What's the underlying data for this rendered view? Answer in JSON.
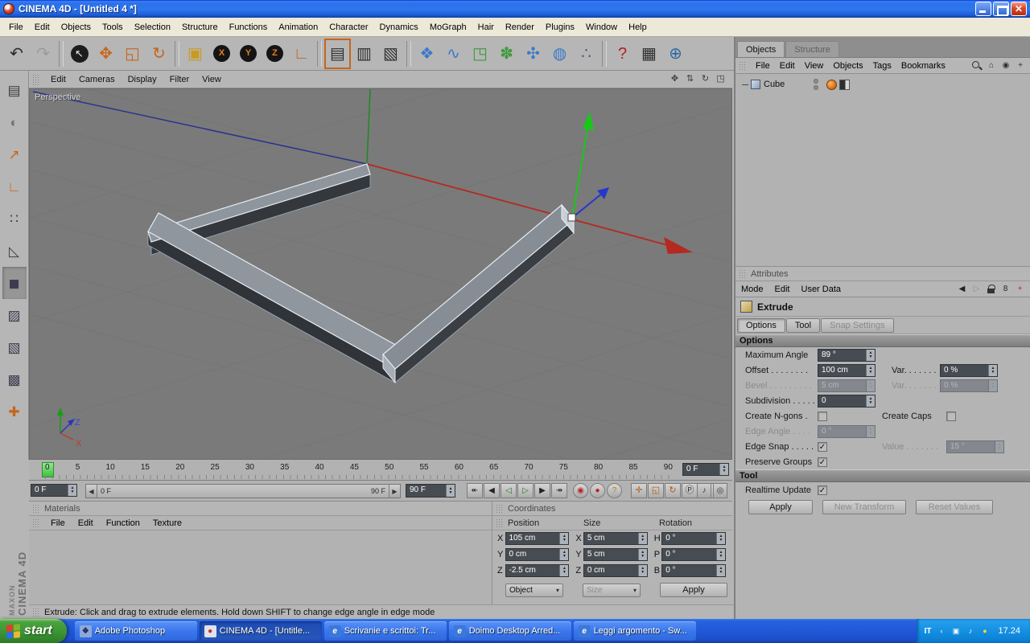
{
  "window": {
    "title": "CINEMA 4D - [Untitled 4 *]"
  },
  "app_menu": [
    "File",
    "Edit",
    "Objects",
    "Tools",
    "Selection",
    "Structure",
    "Functions",
    "Animation",
    "Character",
    "Dynamics",
    "MoGraph",
    "Hair",
    "Render",
    "Plugins",
    "Window",
    "Help"
  ],
  "toolbar": {
    "icons": [
      {
        "name": "undo-icon",
        "glyph": "↶",
        "color": "#2a2a2a"
      },
      {
        "name": "redo-icon",
        "glyph": "↷",
        "color": "#9b9b9b"
      },
      {
        "name": "sep"
      },
      {
        "name": "live-selection-icon",
        "glyph": "↖",
        "kind": "round"
      },
      {
        "name": "move-icon",
        "glyph": "✥",
        "color": "#c8651c"
      },
      {
        "name": "scale-icon",
        "glyph": "◱",
        "color": "#c8651c"
      },
      {
        "name": "rotate-icon",
        "glyph": "↻",
        "color": "#c8651c"
      },
      {
        "name": "sep"
      },
      {
        "name": "last-used-tool-icon",
        "glyph": "▣",
        "color": "#c99b1d"
      },
      {
        "name": "lock-x-icon",
        "kind": "lock",
        "letter": "X"
      },
      {
        "name": "lock-y-icon",
        "kind": "lock",
        "letter": "Y"
      },
      {
        "name": "lock-z-icon",
        "kind": "lock",
        "letter": "Z"
      },
      {
        "name": "coordinate-system-icon",
        "glyph": "∟",
        "color": "#c8651c"
      },
      {
        "name": "sep"
      },
      {
        "name": "render-view-icon",
        "glyph": "▤",
        "color": "#2e2e2e",
        "framed": true
      },
      {
        "name": "render-active-objects-icon",
        "glyph": "▥",
        "color": "#2e2e2e"
      },
      {
        "name": "render-settings-icon",
        "glyph": "▧",
        "color": "#2e2e2e"
      },
      {
        "name": "sep"
      },
      {
        "name": "add-primitive-icon",
        "glyph": "❖",
        "color": "#3a79c9"
      },
      {
        "name": "add-spline-icon",
        "glyph": "∿",
        "color": "#3a79c9"
      },
      {
        "name": "add-nurbs-icon",
        "glyph": "◳",
        "color": "#3f9a3f"
      },
      {
        "name": "add-modeling-icon",
        "glyph": "✽",
        "color": "#3f9a3f"
      },
      {
        "name": "add-deformer-icon",
        "glyph": "✣",
        "color": "#3a79c9"
      },
      {
        "name": "add-environment-icon",
        "glyph": "◍",
        "color": "#3a79c9"
      },
      {
        "name": "add-particles-icon",
        "glyph": "∴",
        "color": "#555577"
      },
      {
        "name": "sep"
      },
      {
        "name": "help-icon",
        "glyph": "?",
        "color": "#b32020"
      },
      {
        "name": "command-manager-icon",
        "glyph": "▦",
        "color": "#2e2e2e"
      },
      {
        "name": "online-help-icon",
        "glyph": "⊕",
        "color": "#2a6aa0"
      }
    ]
  },
  "left_toolbar": {
    "icons": [
      {
        "name": "layout-icon",
        "glyph": "▤",
        "color": "#3e3e3e"
      },
      {
        "name": "make-editable-icon",
        "glyph": "◐",
        "color": "#757575"
      },
      {
        "name": "model-mode-icon",
        "glyph": "↗",
        "color": "#c8651c"
      },
      {
        "name": "object-axis-mode-icon",
        "glyph": "∟",
        "color": "#c8651c"
      },
      {
        "name": "points-mode-icon",
        "glyph": "∷",
        "color": "#3c3c50"
      },
      {
        "name": "edges-mode-icon",
        "glyph": "◺",
        "color": "#3c3c50"
      },
      {
        "name": "polygons-mode-icon",
        "glyph": "◼",
        "color": "#3c3c50",
        "pressed": true
      },
      {
        "name": "texture-mode-icon",
        "glyph": "▨",
        "color": "#3c3c50"
      },
      {
        "name": "texture-axis-mode-icon",
        "glyph": "▧",
        "color": "#3c3c50"
      },
      {
        "name": "uv-mode-icon",
        "glyph": "▩",
        "color": "#3c3c50"
      },
      {
        "name": "snap-settings-icon",
        "glyph": "✚",
        "color": "#c8651c"
      }
    ]
  },
  "viewport": {
    "menu": [
      "Edit",
      "Cameras",
      "Display",
      "Filter",
      "View"
    ],
    "camera_icons": [
      {
        "name": "camera-pan-icon",
        "glyph": "✥"
      },
      {
        "name": "camera-zoom-icon",
        "glyph": "⇅"
      },
      {
        "name": "camera-rotate-icon",
        "glyph": "↻"
      },
      {
        "name": "viewport-toggle-icon",
        "glyph": "◳"
      }
    ],
    "label": "Perspective",
    "axis_labels": {
      "z": "Z",
      "x": "X"
    }
  },
  "timeline": {
    "ticks": [
      "0",
      "5",
      "10",
      "15",
      "20",
      "25",
      "30",
      "35",
      "40",
      "45",
      "50",
      "55",
      "60",
      "65",
      "70",
      "75",
      "80",
      "85",
      "90"
    ],
    "current_frame": "0 F",
    "range_start": "0 F",
    "range_end": "90 F",
    "end_frame": "90 F",
    "transport": [
      {
        "name": "goto-start-button",
        "glyph": "↞",
        "color": "#222"
      },
      {
        "name": "previous-key-button",
        "glyph": "◀",
        "color": "#222"
      },
      {
        "name": "previous-frame-button",
        "glyph": "◁",
        "color": "#1d7a1d"
      },
      {
        "name": "play-button",
        "glyph": "▷",
        "color": "#1d7a1d"
      },
      {
        "name": "next-frame-button",
        "glyph": "▶",
        "color": "#222"
      },
      {
        "name": "goto-end-button",
        "glyph": "↠",
        "color": "#222"
      }
    ],
    "record": [
      {
        "name": "record-keyframe-button",
        "glyph": "◉",
        "color": "#c02020"
      },
      {
        "name": "autokeying-button",
        "glyph": "●",
        "color": "#c02020"
      },
      {
        "name": "keying-options-button",
        "glyph": "?",
        "color": "#d07010"
      }
    ],
    "toggles": [
      {
        "name": "record-position-toggle",
        "glyph": "✛",
        "color": "#b35a10"
      },
      {
        "name": "record-scale-toggle",
        "glyph": "◱",
        "color": "#b35a10"
      },
      {
        "name": "record-rotation-toggle",
        "glyph": "↻",
        "color": "#b35a10"
      },
      {
        "name": "record-parameter-toggle",
        "glyph": "Ⓟ",
        "color": "#333333"
      },
      {
        "name": "record-pla-toggle",
        "glyph": "∙",
        "color": "#333333"
      }
    ],
    "end_icons": [
      {
        "name": "sound-toggle",
        "glyph": "♪",
        "color": "#333333"
      },
      {
        "name": "solo-toggle",
        "glyph": "◎",
        "color": "#333333"
      }
    ]
  },
  "materials": {
    "title": "Materials",
    "menu": [
      "File",
      "Edit",
      "Function",
      "Texture"
    ]
  },
  "coordinates": {
    "title": "Coordinates",
    "headers": [
      "Position",
      "Size",
      "Rotation"
    ],
    "rows": [
      {
        "l1": "X",
        "v1": "105 cm",
        "l2": "X",
        "v2": "5 cm",
        "l3": "H",
        "v3": "0 °"
      },
      {
        "l1": "Y",
        "v1": "0 cm",
        "l2": "Y",
        "v2": "5 cm",
        "l3": "P",
        "v3": "0 °"
      },
      {
        "l1": "Z",
        "v1": "-2.5 cm",
        "l2": "Z",
        "v2": "0 cm",
        "l3": "B",
        "v3": "0 °"
      }
    ],
    "mode_dropdown": "Object",
    "size_dropdown": "Size",
    "apply": "Apply"
  },
  "object_manager": {
    "tabs": [
      {
        "label": "Objects"
      },
      {
        "label": "Structure"
      }
    ],
    "menu": [
      "File",
      "Edit",
      "View",
      "Objects",
      "Tags",
      "Bookmarks"
    ],
    "menu_icons": [
      {
        "name": "search-icon",
        "kind": "css-search"
      },
      {
        "name": "home-icon",
        "glyph": "⌂",
        "color": "#2e2e2e"
      },
      {
        "name": "eye-icon",
        "glyph": "◉",
        "color": "#2e2e2e"
      },
      {
        "name": "add-icon",
        "glyph": "+",
        "color": "#2e2e2e"
      }
    ],
    "objects": [
      {
        "name": "Cube"
      }
    ]
  },
  "attributes": {
    "title": "Attributes",
    "menu": [
      "Mode",
      "Edit",
      "User Data"
    ],
    "menu_icons": [
      {
        "name": "history-back-icon",
        "glyph": "◀",
        "color": "#222222"
      },
      {
        "name": "history-forward-icon",
        "glyph": "▷",
        "color": "#8d8d8d"
      },
      {
        "name": "lock-icon",
        "kind": "lock-shape"
      },
      {
        "name": "link-icon",
        "glyph": "8",
        "color": "#222222"
      },
      {
        "name": "new-expression-icon",
        "glyph": "+",
        "color": "#b33020"
      }
    ],
    "tool_name": "Extrude",
    "tabs": [
      {
        "label": "Options"
      },
      {
        "label": "Tool"
      },
      {
        "label": "Snap Settings"
      }
    ],
    "sections": {
      "options": "Options",
      "tool": "Tool"
    },
    "options": {
      "maximum_angle_label": "Maximum Angle",
      "maximum_angle": "89 °",
      "offset_label": "Offset . . . . . . . .",
      "offset": "100 cm",
      "var1_label": "Var. . . . . . .",
      "var1": "0 %",
      "bevel_label": "Bevel . . . . . . . . .",
      "bevel": "5 cm",
      "var2_label": "Var. . . . . . .",
      "var2": "0 %",
      "subdivision_label": "Subdivision . . . . .",
      "subdivision": "0",
      "create_ngons_label": "Create N-gons .",
      "create_ngons": false,
      "create_caps_label": "Create Caps",
      "create_caps": false,
      "edge_angle_label": "Edge Angle . . . .",
      "edge_angle": "0 °",
      "edge_snap_label": "Edge Snap . . . . .",
      "edge_snap": true,
      "value_label": "Value . . . . . . .",
      "value": "15 °",
      "preserve_groups_label": "Preserve Groups",
      "preserve_groups": true
    },
    "tool": {
      "realtime_update_label": "Realtime Update",
      "realtime_update": true,
      "apply": "Apply",
      "new_transform": "New Transform",
      "reset_values": "Reset Values"
    }
  },
  "status": "Extrude: Click and drag to extrude elements. Hold down SHIFT to change edge angle in edge mode",
  "branding": {
    "line1": "MAXON",
    "line2": "CINEMA 4D"
  },
  "taskbar": {
    "start": "start",
    "items": [
      {
        "label": "Adobe Photoshop",
        "icon": "ps"
      },
      {
        "label": "CINEMA 4D - [Untitle...",
        "icon": "c4d",
        "active": true
      },
      {
        "label": "Scrivanie e scrittoi: Tr...",
        "icon": "ie"
      },
      {
        "label": "Doimo Desktop Arred...",
        "icon": "ie"
      },
      {
        "label": "Leggi argomento - Sw...",
        "icon": "ie"
      }
    ],
    "tray": {
      "lang": "IT",
      "icons": [
        {
          "name": "hide-icons-button",
          "glyph": "‹"
        },
        {
          "name": "display-settings-icon",
          "glyph": "▣"
        },
        {
          "name": "volume-icon",
          "glyph": "♪"
        },
        {
          "name": "antivirus-icon",
          "glyph": "●",
          "color": "#ffd34d"
        }
      ],
      "time": "17.24"
    }
  }
}
